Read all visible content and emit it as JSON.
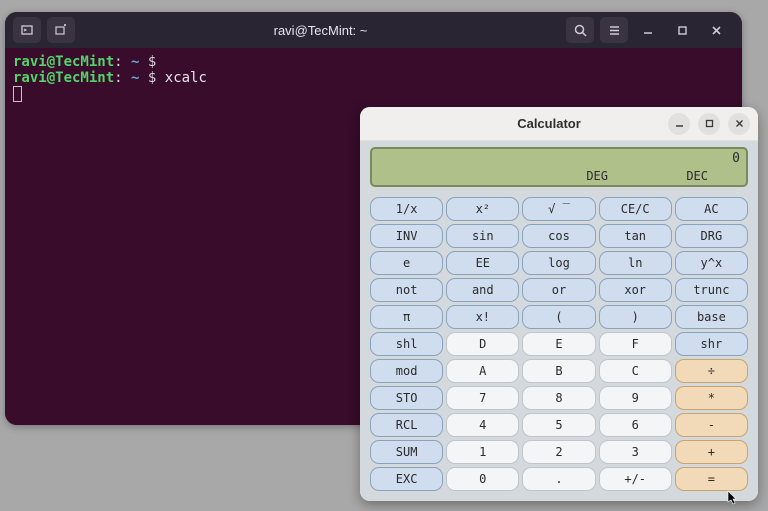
{
  "terminal": {
    "title": "ravi@TecMint: ~",
    "prompt_user": "ravi@TecMint",
    "prompt_path": "~",
    "prompt_symbol": "$",
    "line2_cmd": "xcalc"
  },
  "calculator": {
    "title": "Calculator",
    "display": {
      "value": "0",
      "mode_angle": "DEG",
      "mode_base": "DEC"
    },
    "buttons": [
      {
        "label": "1/x",
        "style": "blue"
      },
      {
        "label": "x²",
        "style": "blue"
      },
      {
        "label": "√ ‾",
        "style": "blue"
      },
      {
        "label": "CE/C",
        "style": "blue"
      },
      {
        "label": "AC",
        "style": "blue"
      },
      {
        "label": "INV",
        "style": "blue"
      },
      {
        "label": "sin",
        "style": "blue"
      },
      {
        "label": "cos",
        "style": "blue"
      },
      {
        "label": "tan",
        "style": "blue"
      },
      {
        "label": "DRG",
        "style": "blue"
      },
      {
        "label": "e",
        "style": "blue"
      },
      {
        "label": "EE",
        "style": "blue"
      },
      {
        "label": "log",
        "style": "blue"
      },
      {
        "label": "ln",
        "style": "blue"
      },
      {
        "label": "y^x",
        "style": "blue"
      },
      {
        "label": "not",
        "style": "blue"
      },
      {
        "label": "and",
        "style": "blue"
      },
      {
        "label": "or",
        "style": "blue"
      },
      {
        "label": "xor",
        "style": "blue"
      },
      {
        "label": "trunc",
        "style": "blue"
      },
      {
        "label": "π",
        "style": "blue"
      },
      {
        "label": "x!",
        "style": "blue"
      },
      {
        "label": "(",
        "style": "blue"
      },
      {
        "label": ")",
        "style": "blue"
      },
      {
        "label": "base",
        "style": "blue"
      },
      {
        "label": "shl",
        "style": "blue"
      },
      {
        "label": "D",
        "style": "white"
      },
      {
        "label": "E",
        "style": "white"
      },
      {
        "label": "F",
        "style": "white"
      },
      {
        "label": "shr",
        "style": "blue"
      },
      {
        "label": "mod",
        "style": "blue"
      },
      {
        "label": "A",
        "style": "white"
      },
      {
        "label": "B",
        "style": "white"
      },
      {
        "label": "C",
        "style": "white"
      },
      {
        "label": "÷",
        "style": "orange"
      },
      {
        "label": "STO",
        "style": "blue"
      },
      {
        "label": "7",
        "style": "white"
      },
      {
        "label": "8",
        "style": "white"
      },
      {
        "label": "9",
        "style": "white"
      },
      {
        "label": "*",
        "style": "orange"
      },
      {
        "label": "RCL",
        "style": "blue"
      },
      {
        "label": "4",
        "style": "white"
      },
      {
        "label": "5",
        "style": "white"
      },
      {
        "label": "6",
        "style": "white"
      },
      {
        "label": "-",
        "style": "orange"
      },
      {
        "label": "SUM",
        "style": "blue"
      },
      {
        "label": "1",
        "style": "white"
      },
      {
        "label": "2",
        "style": "white"
      },
      {
        "label": "3",
        "style": "white"
      },
      {
        "label": "+",
        "style": "orange"
      },
      {
        "label": "EXC",
        "style": "blue"
      },
      {
        "label": "0",
        "style": "white"
      },
      {
        "label": ".",
        "style": "white"
      },
      {
        "label": "+/-",
        "style": "white"
      },
      {
        "label": "=",
        "style": "orange"
      }
    ]
  }
}
